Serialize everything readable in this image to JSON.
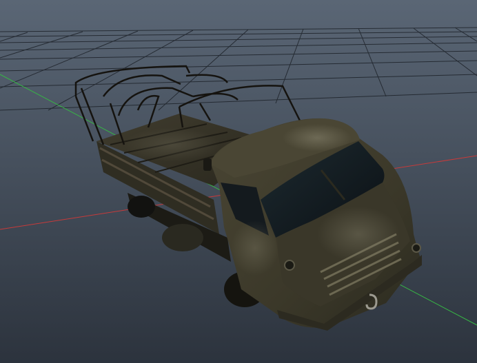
{
  "viewport": {
    "background_top": "#5a6675",
    "background_bottom": "#2f3743",
    "grid_color": "#1e232a",
    "axis_x_color": "#d23c3c",
    "axis_z_color": "#3ec24a"
  },
  "model": {
    "body_color": "#3d3a2c",
    "body_dark": "#25241c",
    "body_highlight": "#6d6a58",
    "glass_color": "#0f1418",
    "frame_color": "#15130f",
    "rust_color": "#6a4a30"
  }
}
